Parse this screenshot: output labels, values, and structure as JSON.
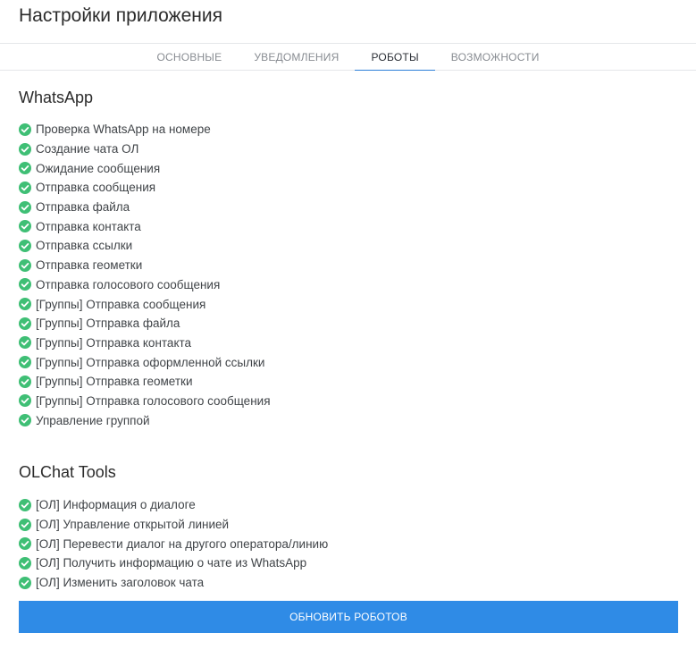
{
  "page": {
    "title": "Настройки приложения"
  },
  "tabs": [
    {
      "label": "ОСНОВНЫЕ",
      "active": false
    },
    {
      "label": "УВЕДОМЛЕНИЯ",
      "active": false
    },
    {
      "label": "РОБОТЫ",
      "active": true
    },
    {
      "label": "ВОЗМОЖНОСТИ",
      "active": false
    }
  ],
  "colors": {
    "accent": "#2f8be6",
    "check": "#3fbf75",
    "tab_underline": "#2b7fd9"
  },
  "sections": [
    {
      "title": "WhatsApp",
      "items": [
        "Проверка WhatsApp на номере",
        "Создание чата ОЛ",
        "Ожидание сообщения",
        "Отправка сообщения",
        "Отправка файла",
        "Отправка контакта",
        "Отправка ссылки",
        "Отправка геометки",
        "Отправка голосового сообщения",
        "[Группы] Отправка сообщения",
        "[Группы] Отправка файла",
        "[Группы] Отправка контакта",
        "[Группы] Отправка оформленной ссылки",
        "[Группы] Отправка геометки",
        "[Группы] Отправка голосового сообщения",
        "Управление группой"
      ]
    },
    {
      "title": "OLChat Tools",
      "items": [
        "[ОЛ] Информация о диалоге",
        "[ОЛ] Управление открытой линией",
        "[ОЛ] Перевести диалог на другого оператора/линию",
        "[ОЛ] Получить информацию о чате из WhatsApp",
        "[ОЛ] Изменить заголовок чата"
      ]
    }
  ],
  "item_icon": "check-circle-icon",
  "update_button": {
    "label": "ОБНОВИТЬ РОБОТОВ"
  }
}
